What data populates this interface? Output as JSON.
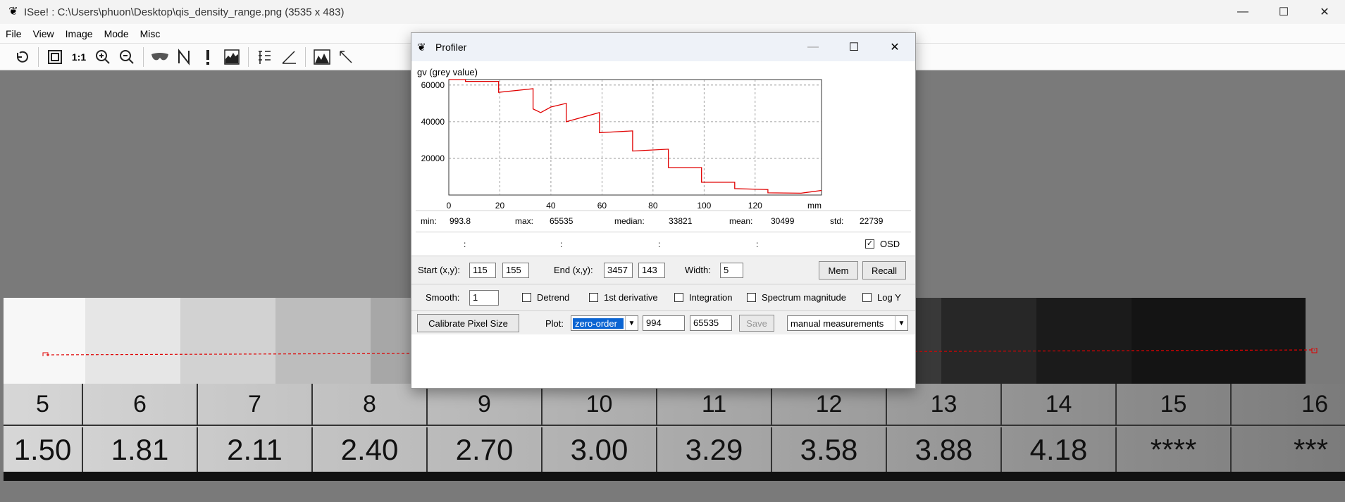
{
  "window": {
    "title": "ISee! : C:\\Users\\phuon\\Desktop\\qis_density_range.png (3535 x 483)",
    "minimize": "—",
    "maximize": "☐",
    "close": "✕"
  },
  "menu": [
    "File",
    "View",
    "Image",
    "Mode",
    "Misc"
  ],
  "toolbar": {
    "one_to_one": "1:1"
  },
  "strip": {
    "numbers": [
      "5",
      "6",
      "7",
      "8",
      "9",
      "10",
      "11",
      "12",
      "13",
      "14",
      "15",
      "16"
    ],
    "densities": [
      "1.50",
      "1.81",
      "2.11",
      "2.40",
      "2.70",
      "3.00",
      "3.29",
      "3.58",
      "3.88",
      "4.18",
      "****",
      "***"
    ]
  },
  "profiler": {
    "title": "Profiler",
    "ylabel": "gv (grey value)",
    "xunit": "mm",
    "stats": {
      "min_label": "min:",
      "min": "993.8",
      "max_label": "max:",
      "max": "65535",
      "median_label": "median:",
      "median": "33821",
      "mean_label": "mean:",
      "mean": "30499",
      "std_label": "std:",
      "std": "22739"
    },
    "colons": [
      ":",
      ":",
      ":",
      ":"
    ],
    "osd_label": "OSD",
    "osd_checked": "✓",
    "start_label": "Start (x,y):",
    "start_x": "115",
    "start_y": "155",
    "end_label": "End (x,y):",
    "end_x": "3457",
    "end_y": "143",
    "width_label": "Width:",
    "width": "5",
    "mem_button": "Mem",
    "recall_button": "Recall",
    "smooth_label": "Smooth:",
    "smooth": "1",
    "detrend_label": "Detrend",
    "derivative_label": "1st derivative",
    "integration_label": "Integration",
    "spectrum_label": "Spectrum magnitude",
    "logy_label": "Log Y",
    "calibrate_button": "Calibrate Pixel Size",
    "plot_label": "Plot:",
    "plot_mode": "zero-order",
    "plot_min": "994",
    "plot_max": "65535",
    "save_button": "Save",
    "measure_mode": "manual measurements"
  },
  "chart_data": {
    "type": "line",
    "ylabel": "gv (grey value)",
    "xlabel": "mm",
    "xlim": [
      0,
      146
    ],
    "ylim": [
      0,
      63000
    ],
    "xticks": [
      0,
      20,
      40,
      60,
      80,
      100,
      120
    ],
    "yticks": [
      20000,
      40000,
      60000
    ],
    "grid": true,
    "series": [
      {
        "color": "#e00000",
        "x": [
          0,
          6.5,
          6.5,
          19.5,
          19.5,
          33,
          33,
          36,
          40,
          46,
          46,
          59,
          59,
          72,
          72,
          86,
          86,
          99,
          99,
          112,
          112,
          125,
          125,
          138,
          146
        ],
        "y": [
          63000,
          63000,
          62000,
          62000,
          56000,
          58000,
          47000,
          45000,
          48000,
          50000,
          40000,
          45000,
          34000,
          35000,
          24000,
          25000,
          15000,
          15000,
          7000,
          7000,
          3500,
          3000,
          1200,
          1000,
          2500
        ]
      }
    ]
  },
  "colors": {
    "profile_line": "#e00000",
    "accent": "#0a64d2"
  }
}
